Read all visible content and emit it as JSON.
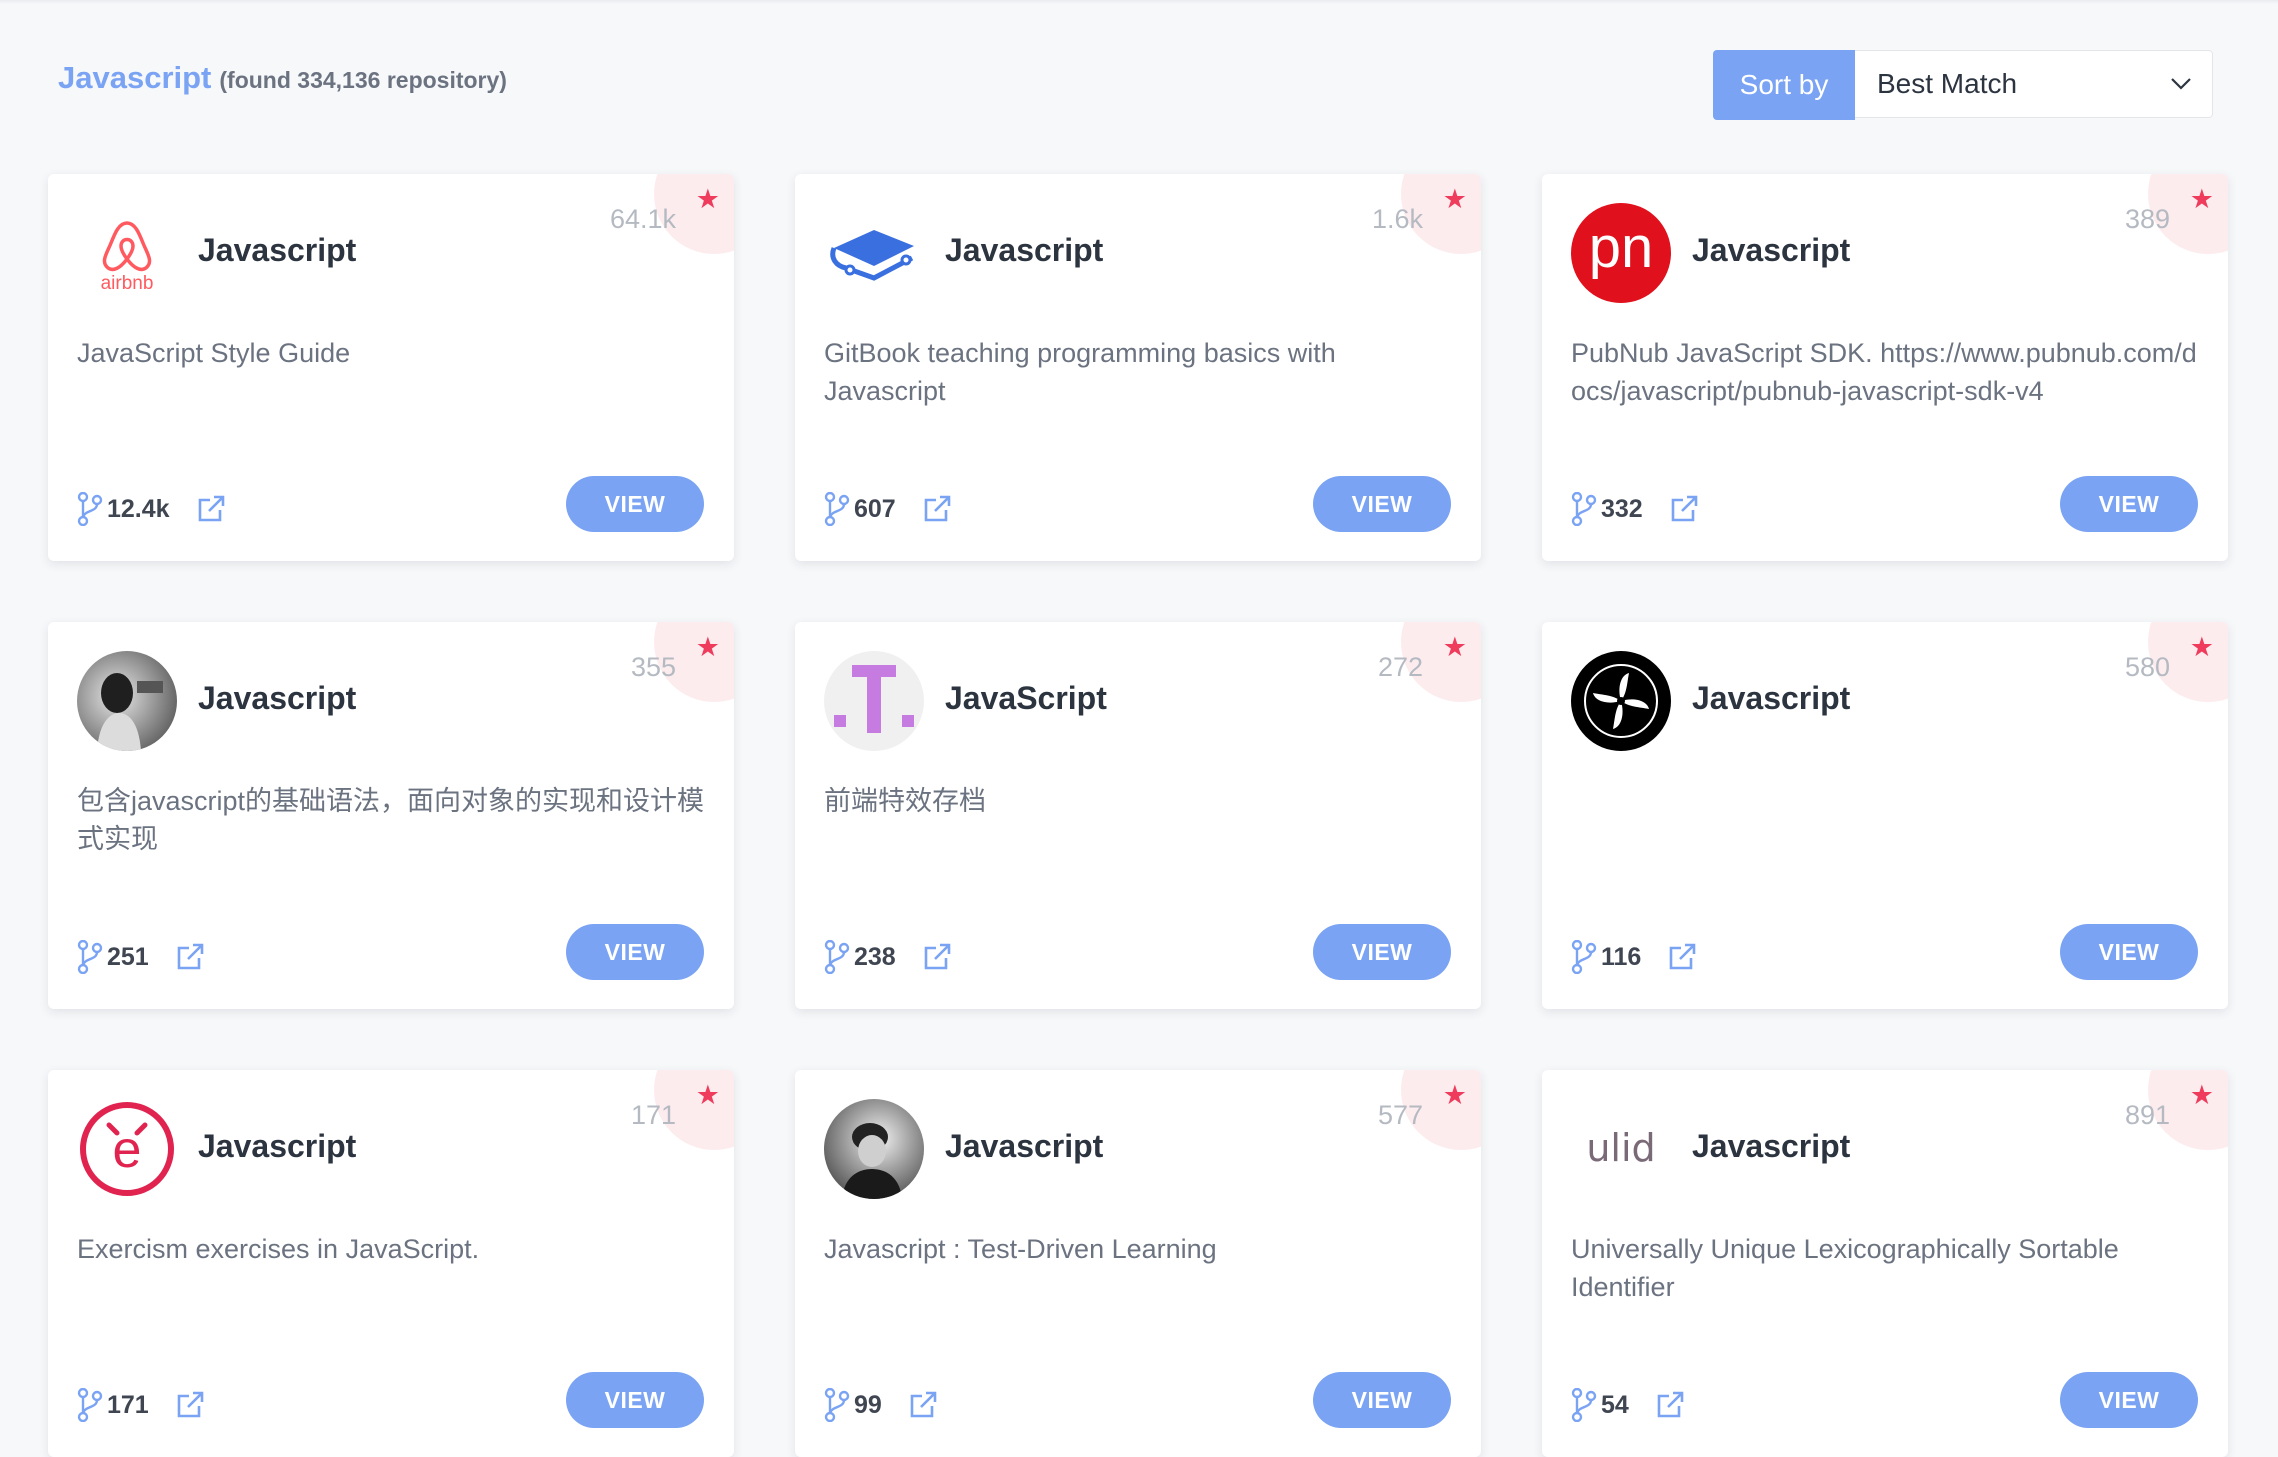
{
  "header": {
    "query": "Javascript",
    "found_text": "(found 334,136 repository)"
  },
  "sort": {
    "label": "Sort by",
    "selected": "Best Match"
  },
  "colors": {
    "accent": "#7aa3f4",
    "star": "#ef3c5c"
  },
  "view_label": "VIEW",
  "cards": [
    {
      "name": "Javascript",
      "stars": "64.1k",
      "desc": "JavaScript Style Guide",
      "forks": "12.4k",
      "avatar": "airbnb-logo"
    },
    {
      "name": "Javascript",
      "stars": "1.6k",
      "desc": "GitBook teaching programming basics with Javascript",
      "forks": "607",
      "avatar": "book-logo"
    },
    {
      "name": "Javascript",
      "stars": "389",
      "desc": "PubNub JavaScript SDK. https://www.pubnub.com/docs/javascript/pubnub-javascript-sdk-v4",
      "forks": "332",
      "avatar": "pubnub-logo"
    },
    {
      "name": "Javascript",
      "stars": "355",
      "desc": "包含javascript的基础语法，面向对象的实现和设计模式实现",
      "forks": "251",
      "avatar": "user-photo"
    },
    {
      "name": "JavaScript",
      "stars": "272",
      "desc": "前端特效存档",
      "forks": "238",
      "avatar": "t-logo"
    },
    {
      "name": "Javascript",
      "stars": "580",
      "desc": "",
      "forks": "116",
      "avatar": "fan-logo"
    },
    {
      "name": "Javascript",
      "stars": "171",
      "desc": "Exercism exercises in JavaScript.",
      "forks": "171",
      "avatar": "exercism-logo"
    },
    {
      "name": "Javascript",
      "stars": "577",
      "desc": "Javascript : Test-Driven Learning",
      "forks": "99",
      "avatar": "user-photo-2"
    },
    {
      "name": "Javascript",
      "stars": "891",
      "desc": "Universally Unique Lexicographically Sortable Identifier",
      "forks": "54",
      "avatar": "ulid-logo"
    }
  ]
}
